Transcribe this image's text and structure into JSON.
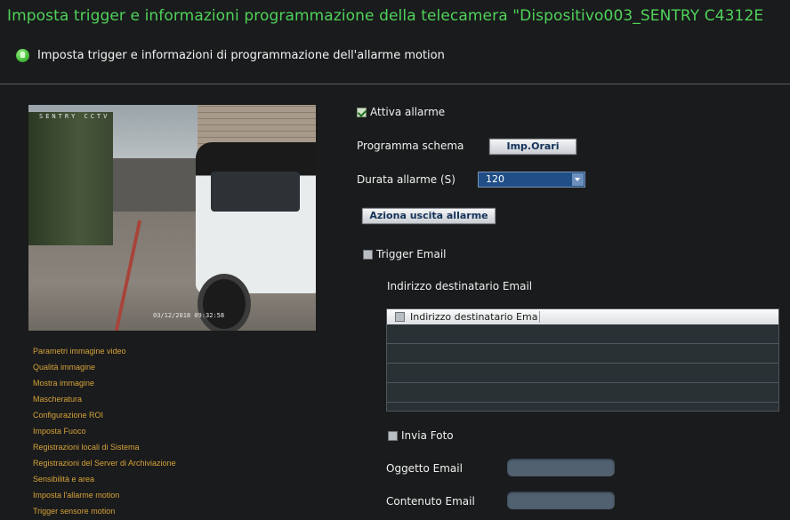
{
  "header": {
    "title": "Imposta trigger e informazioni programmazione della telecamera \"Dispositivo003_SENTRY C4312E",
    "subtitle": "Imposta trigger e informazioni di programmazione dell'allarme motion"
  },
  "preview": {
    "osd_name": "SENTRY CCTV",
    "osd_timestamp": "03/12/2018 09:32:58"
  },
  "nav": {
    "items": [
      "Parametri immagine video",
      "Qualità immagine",
      "Mostra immagine",
      "Mascheratura",
      "Configurazione ROI",
      "Imposta Fuoco",
      "Registrazioni locali di Sistema",
      "Registrazioni del Server di Archiviazione",
      "Sensibilità e area",
      "Imposta l'allarme motion",
      "Trigger sensore motion"
    ]
  },
  "form": {
    "enable_alarm": {
      "label": "Attiva allarme",
      "checked": true
    },
    "schedule": {
      "label": "Programma schema",
      "button": "Imp.Orari"
    },
    "duration": {
      "label": "Durata allarme (S)",
      "value": "120"
    },
    "trigger_output_button": "Aziona uscita allarme",
    "trigger_email": {
      "label": "Trigger Email",
      "checked": false
    },
    "recipient_label": "Indirizzo destinatario Email",
    "recipient_table": {
      "column": "Indirizzo  destinatario Ema",
      "rows": []
    },
    "send_photo": {
      "label": "Invia Foto",
      "checked": false
    },
    "subject_label": "Oggetto Email",
    "content_label": "Contenuto Email"
  },
  "colors": {
    "title": "#4fd25a",
    "nav_text": "#d5a23a",
    "background": "#1a1b1c",
    "select_bg": "#1f4f86"
  }
}
